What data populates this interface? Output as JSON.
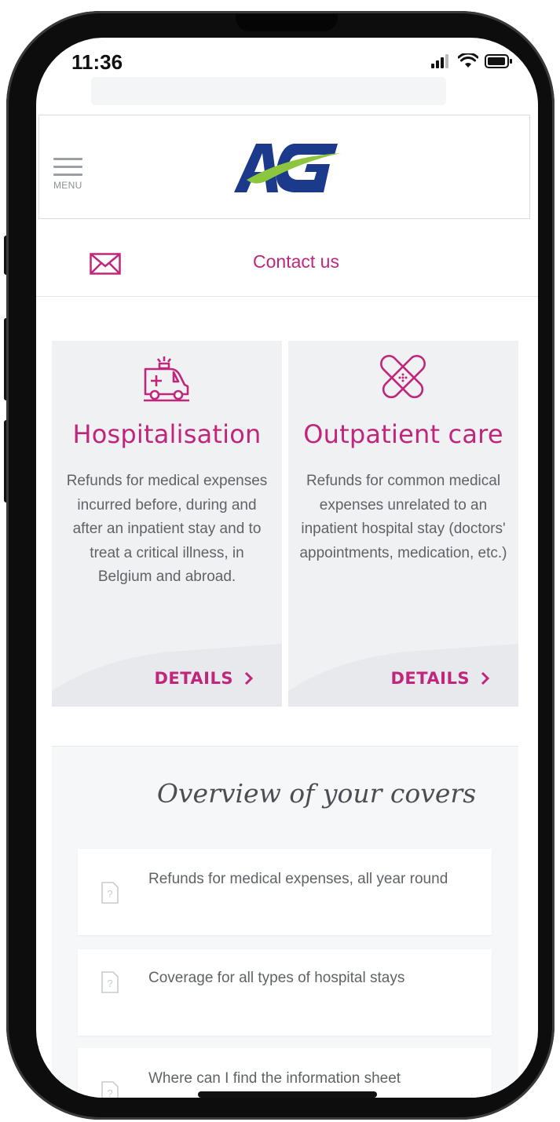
{
  "status_bar": {
    "time": "11:36"
  },
  "header": {
    "menu_label": "MENU",
    "logo_alt": "AG"
  },
  "contact": {
    "label": "Contact us"
  },
  "cards": [
    {
      "title": "Hospitalisation",
      "description": "Refunds for medical expenses incurred before, during and after an inpatient stay and to treat a critical illness, in Belgium and abroad.",
      "cta": "DETAILS",
      "icon": "ambulance-icon"
    },
    {
      "title": "Outpatient care",
      "description": "Refunds for common medical expenses unrelated to an inpatient hospital stay (doctors' appointments, medication, etc.)",
      "cta": "DETAILS",
      "icon": "bandage-icon"
    }
  ],
  "overview": {
    "title": "Overview of your covers",
    "items": [
      {
        "text": "Refunds for medical expenses, all year round"
      },
      {
        "text": "Coverage for all types of hospital stays"
      },
      {
        "text": "Where can I find the information sheet"
      }
    ]
  },
  "colors": {
    "accent": "#c0267c",
    "logo_blue": "#1b3a8c",
    "logo_green": "#8cc63f",
    "card_bg": "#eff1f3",
    "text_gray": "#5f6368"
  }
}
